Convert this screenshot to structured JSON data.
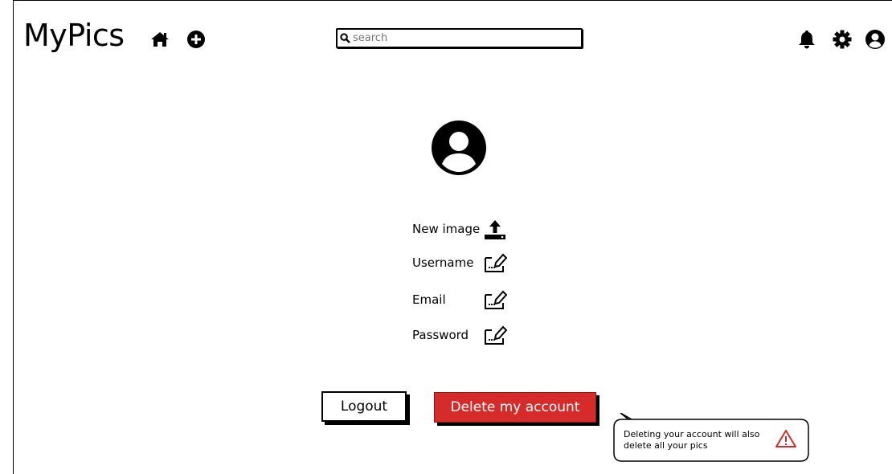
{
  "header": {
    "app_title": "MyPics",
    "home_icon": "home-icon",
    "add_icon": "plus-circle-icon",
    "search": {
      "placeholder": "search",
      "value": ""
    },
    "right_icons": [
      "bell-icon",
      "gear-icon",
      "user-circle-icon"
    ]
  },
  "profile": {
    "avatar_icon": "user-avatar-icon",
    "fields": [
      {
        "label": "New image",
        "icon": "upload-icon"
      },
      {
        "label": "Username",
        "icon": "edit-icon"
      },
      {
        "label": "Email",
        "icon": "edit-icon"
      },
      {
        "label": "Password",
        "icon": "edit-icon"
      }
    ]
  },
  "actions": {
    "logout_label": "Logout",
    "delete_label": "Delete my account"
  },
  "callout": {
    "text": "Deleting your account will also delete all your pics",
    "icon": "warning-icon"
  },
  "colors": {
    "danger": "#d62b2b",
    "warning_icon": "#d62b2b",
    "ink": "#000000"
  }
}
